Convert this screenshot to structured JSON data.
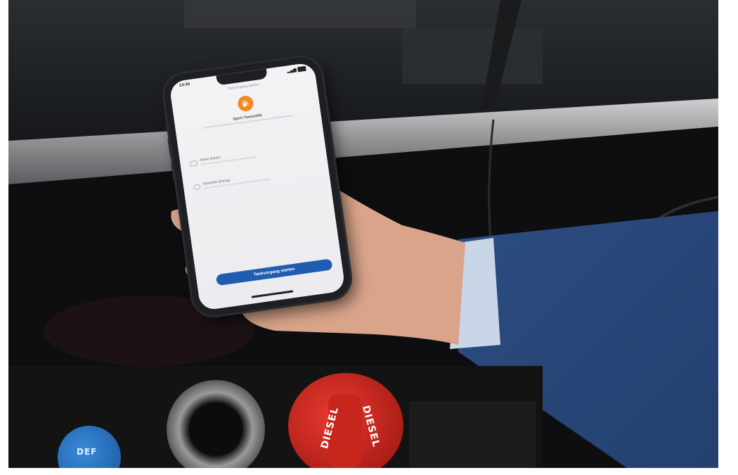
{
  "phone": {
    "status_time": "14:34",
    "screen_title": "Tankvorgang starten",
    "station_name": "Spirit Tankstelle",
    "rows": [
      {
        "label": "Aktive Karten",
        "icon": "card-icon"
      },
      {
        "label": "Kilometer Eintrag",
        "icon": "odometer-icon"
      }
    ],
    "start_button_label": "Tankvorgang starten",
    "accent_color": "#f08a24",
    "button_color": "#1f5db0"
  },
  "caps": {
    "diesel_left": "DIESEL",
    "diesel_right": "DIESEL",
    "def_cap": "DEF"
  }
}
